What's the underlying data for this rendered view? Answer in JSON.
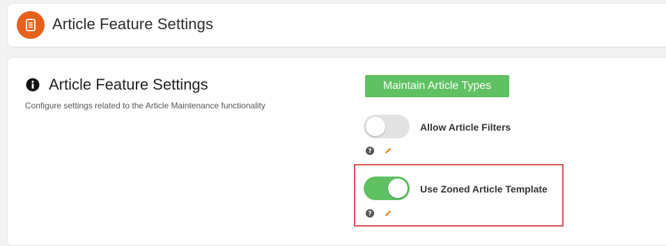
{
  "header": {
    "title": "Article Feature Settings",
    "icon": "document-icon",
    "icon_color": "#e8611a"
  },
  "section": {
    "title": "Article Feature Settings",
    "icon": "info-icon",
    "description": "Configure settings related to the Article Maintenance functionality"
  },
  "actions": {
    "maintain_label": "Maintain Article Types",
    "maintain_color": "#5fc162"
  },
  "settings": [
    {
      "label": "Allow Article Filters",
      "enabled": false,
      "icons": [
        "help-icon",
        "edit-icon"
      ]
    },
    {
      "label": "Use Zoned Article Template",
      "enabled": true,
      "highlighted": true,
      "icons": [
        "help-icon",
        "edit-icon"
      ]
    }
  ],
  "colors": {
    "toggle_on": "#5fc162",
    "toggle_off": "#e2e2e2",
    "edit_icon": "#f08a24",
    "highlight": "#d9534f"
  }
}
